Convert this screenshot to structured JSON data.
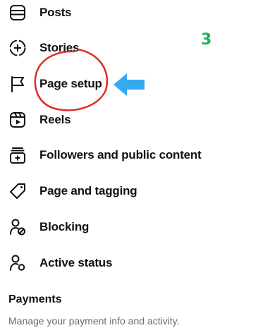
{
  "menu": {
    "items": [
      {
        "label": "Posts",
        "icon": "posts-icon"
      },
      {
        "label": "Stories",
        "icon": "stories-add-icon"
      },
      {
        "label": "Page setup",
        "icon": "flag-icon"
      },
      {
        "label": "Reels",
        "icon": "reels-icon"
      },
      {
        "label": "Followers and public content",
        "icon": "followers-content-icon"
      },
      {
        "label": "Page and tagging",
        "icon": "tag-icon"
      },
      {
        "label": "Blocking",
        "icon": "blocking-user-icon"
      },
      {
        "label": "Active status",
        "icon": "active-status-user-icon"
      }
    ]
  },
  "payments": {
    "title": "Payments",
    "description": "Manage your payment info and activity."
  },
  "annotation": {
    "step_number": "3",
    "step_color": "#1fb35a",
    "circle_color": "#e02a2a",
    "arrow_color": "#35aaf0"
  }
}
